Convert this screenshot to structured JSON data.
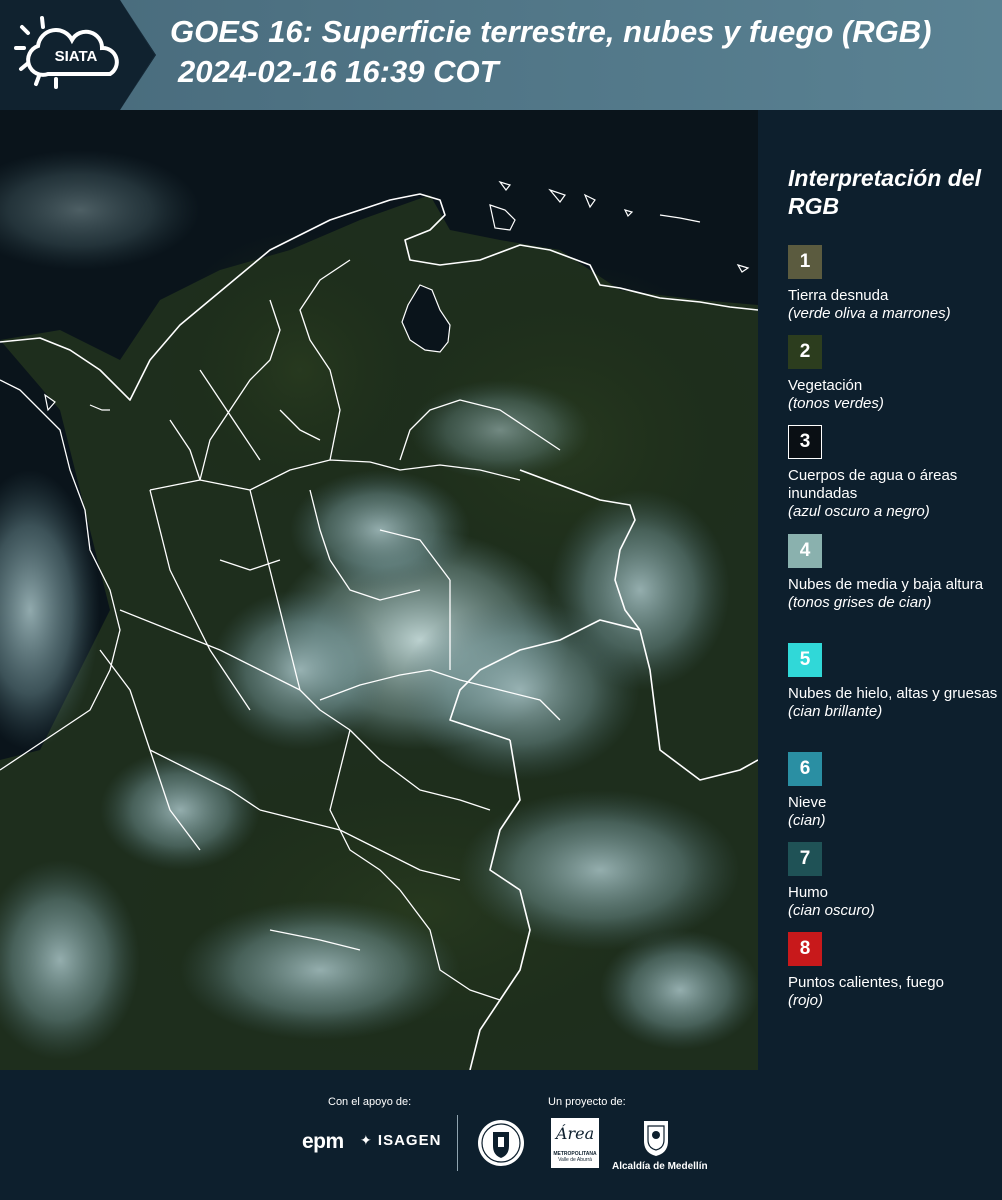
{
  "header": {
    "logo_text": "SIATA",
    "title": "GOES 16: Superficie terrestre, nubes y fuego (RGB)",
    "timestamp": "2024-02-16 16:39 COT"
  },
  "legend": {
    "title": "Interpretación del RGB",
    "items": [
      {
        "number": "1",
        "label": "Tierra desnuda",
        "note": "(verde oliva a marrones)",
        "color": "#5b5b3f"
      },
      {
        "number": "2",
        "label": "Vegetación",
        "note": "(tonos verdes)",
        "color": "#2c3d1e"
      },
      {
        "number": "3",
        "label": "Cuerpos de agua o áreas inundadas",
        "note": "(azul oscuro a negro)",
        "color": "#0a0f14"
      },
      {
        "number": "4",
        "label": "Nubes de media y baja altura",
        "note": "(tonos grises de cian)",
        "color": "#8ab1ae"
      },
      {
        "number": "5",
        "label": "Nubes de hielo, altas y gruesas",
        "note": "(cian brillante)",
        "color": "#30d8d8"
      },
      {
        "number": "6",
        "label": "Nieve",
        "note": "(cian)",
        "color": "#2a8fa3"
      },
      {
        "number": "7",
        "label": "Humo",
        "note": "(cian oscuro)",
        "color": "#1f5256"
      },
      {
        "number": "8",
        "label": "Puntos calientes, fuego",
        "note": "(rojo)",
        "color": "#c8191b"
      }
    ]
  },
  "footer": {
    "support_label": "Con el apoyo de:",
    "project_label": "Un proyecto de:",
    "sponsor_1": "epm",
    "sponsor_2": "ISAGEN",
    "partner_amva_line1": "Área",
    "partner_amva_line2": "METROPOLITANA",
    "partner_amva_line3": "Valle de Aburrá",
    "partner_alcaldia": "Alcaldía de Medellín"
  }
}
